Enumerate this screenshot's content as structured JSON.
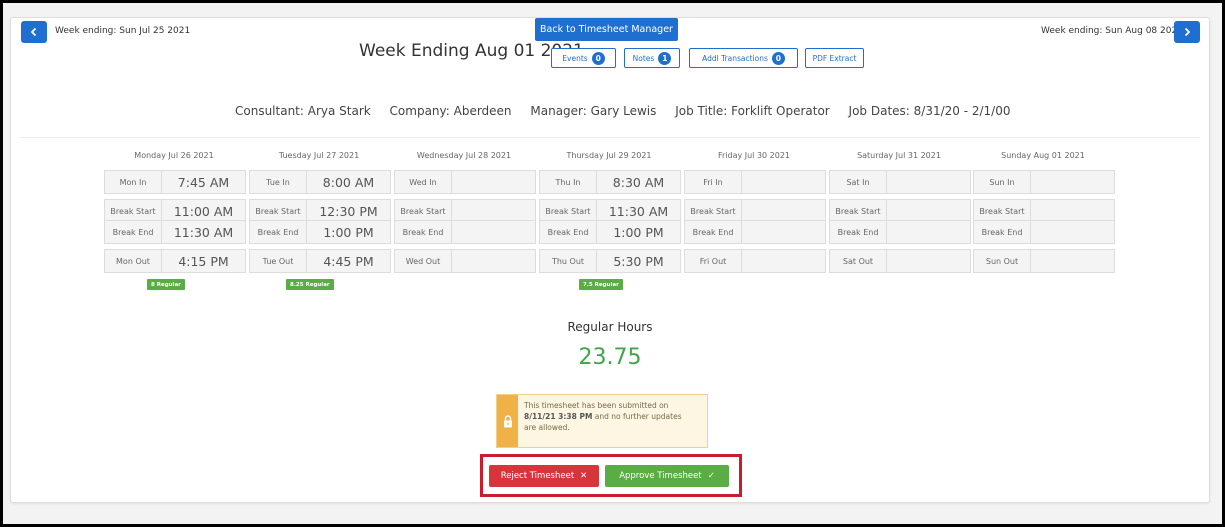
{
  "nav": {
    "prev_label": "Week ending: Sun Jul 25 2021",
    "next_label": "Week ending: Sun Aug 08 2021",
    "back_button": "Back to Timesheet Manager"
  },
  "header": {
    "title": "Week Ending Aug 01 2021",
    "events_label": "Events",
    "events_count": "0",
    "notes_label": "Notes",
    "notes_count": "1",
    "transactions_label": "Addl Transactions",
    "transactions_count": "0",
    "pdf_label": "PDF Extract"
  },
  "info": {
    "consultant": "Consultant: Arya Stark",
    "company": "Company: Aberdeen",
    "manager": "Manager: Gary Lewis",
    "job_title": "Job Title: Forklift Operator",
    "job_dates": "Job Dates: 8/31/20 - 2/1/00"
  },
  "days": [
    {
      "heading": "Monday Jul 26 2021",
      "in_label": "Mon In",
      "in": "7:45 AM",
      "bs_label": "Break Start",
      "bs": "11:00 AM",
      "be_label": "Break End",
      "be": "11:30 AM",
      "out_label": "Mon Out",
      "out": "4:15 PM",
      "hours": "8 Regular"
    },
    {
      "heading": "Tuesday Jul 27 2021",
      "in_label": "Tue In",
      "in": "8:00 AM",
      "bs_label": "Break Start",
      "bs": "12:30 PM",
      "be_label": "Break End",
      "be": "1:00 PM",
      "out_label": "Tue Out",
      "out": "4:45 PM",
      "hours": "8.25 Regular"
    },
    {
      "heading": "Wednesday Jul 28 2021",
      "in_label": "Wed In",
      "in": "",
      "bs_label": "Break Start",
      "bs": "",
      "be_label": "Break End",
      "be": "",
      "out_label": "Wed Out",
      "out": "",
      "hours": ""
    },
    {
      "heading": "Thursday Jul 29 2021",
      "in_label": "Thu In",
      "in": "8:30 AM",
      "bs_label": "Break Start",
      "bs": "11:30 AM",
      "be_label": "Break End",
      "be": "1:00 PM",
      "out_label": "Thu Out",
      "out": "5:30 PM",
      "hours": "7.5 Regular"
    },
    {
      "heading": "Friday Jul 30 2021",
      "in_label": "Fri In",
      "in": "",
      "bs_label": "Break Start",
      "bs": "",
      "be_label": "Break End",
      "be": "",
      "out_label": "Fri Out",
      "out": "",
      "hours": ""
    },
    {
      "heading": "Saturday Jul 31 2021",
      "in_label": "Sat In",
      "in": "",
      "bs_label": "Break Start",
      "bs": "",
      "be_label": "Break End",
      "be": "",
      "out_label": "Sat Out",
      "out": "",
      "hours": ""
    },
    {
      "heading": "Sunday Aug 01 2021",
      "in_label": "Sun In",
      "in": "",
      "bs_label": "Break Start",
      "bs": "",
      "be_label": "Break End",
      "be": "",
      "out_label": "Sun Out",
      "out": "",
      "hours": ""
    }
  ],
  "summary": {
    "label": "Regular Hours",
    "value": "23.75"
  },
  "notice": {
    "line1": "This timesheet has been submitted on",
    "datetime": "8/11/21 3:38 PM",
    "line2": " and no further updates",
    "line3": "are allowed."
  },
  "actions": {
    "reject": "Reject Timesheet",
    "approve": "Approve Timesheet"
  },
  "colors": {
    "primary": "#1f6fd1",
    "success": "#5aad45",
    "danger": "#d6353b",
    "warning": "#f0b246"
  }
}
